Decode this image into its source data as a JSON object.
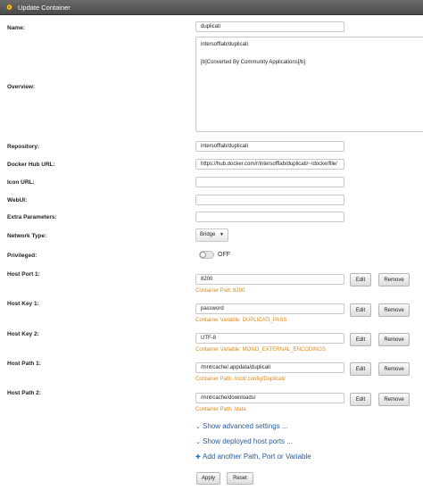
{
  "titlebar": {
    "title": "Update Container",
    "icon": "gear-icon"
  },
  "fields": {
    "name": {
      "label": "Name:",
      "value": "duplicati"
    },
    "overview": {
      "label": "Overview:",
      "line1": "intersofflab/duplicati",
      "line2": "[b]Converted By Community Applications[/b]"
    },
    "repository": {
      "label": "Repository:",
      "value": "intersofflab/duplicati"
    },
    "docker_hub_url": {
      "label": "Docker Hub URL:",
      "value": "https://hub.docker.com/r/intersofflab/duplicati/~/dockerfile/"
    },
    "icon_url": {
      "label": "Icon URL:",
      "value": ""
    },
    "webui": {
      "label": "WebUI:",
      "value": ""
    },
    "extra_parameters": {
      "label": "Extra Parameters:",
      "value": ""
    },
    "network_type": {
      "label": "Network Type:",
      "value": "Bridge"
    },
    "privileged": {
      "label": "Privileged:",
      "state": "OFF"
    }
  },
  "mappings": [
    {
      "label": "Host Port 1:",
      "value": "8200",
      "hint": "Container Port: 8200"
    },
    {
      "label": "Host Key 1:",
      "value": "password",
      "hint": "Container Variable: DUPLICATI_PASS"
    },
    {
      "label": "Host Key 2:",
      "value": "UTF-8",
      "hint": "Container Variable: MONO_EXTERNAL_ENCODINGS"
    },
    {
      "label": "Host Path 1:",
      "value": "/mnt/cache/.appdata/duplicati",
      "hint": "Container Path: /root/.config/Duplicati/"
    },
    {
      "label": "Host Path 2:",
      "value": "/mnt/cache/downloads/",
      "hint": "Container Path: /data"
    }
  ],
  "buttons": {
    "edit": "Edit",
    "remove": "Remove",
    "apply": "Apply",
    "reset": "Reset"
  },
  "links": {
    "advanced": "Show advanced settings ...",
    "deployed": "Show deployed host ports ...",
    "add": "Add another Path, Port or Variable"
  },
  "colors": {
    "hint": "#d9891c",
    "link": "#2a5a9a",
    "titlebar": "#555555"
  }
}
